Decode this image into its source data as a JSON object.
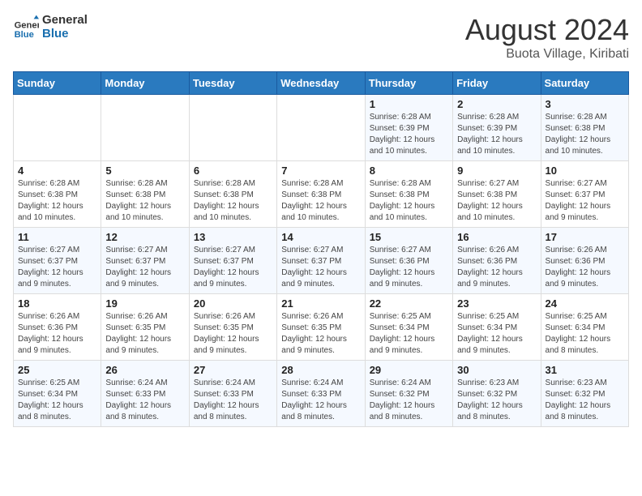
{
  "header": {
    "logo_general": "General",
    "logo_blue": "Blue",
    "title": "August 2024",
    "subtitle": "Buota Village, Kiribati"
  },
  "columns": [
    "Sunday",
    "Monday",
    "Tuesday",
    "Wednesday",
    "Thursday",
    "Friday",
    "Saturday"
  ],
  "weeks": [
    [
      {
        "day": "",
        "info": ""
      },
      {
        "day": "",
        "info": ""
      },
      {
        "day": "",
        "info": ""
      },
      {
        "day": "",
        "info": ""
      },
      {
        "day": "1",
        "info": "Sunrise: 6:28 AM\nSunset: 6:39 PM\nDaylight: 12 hours and 10 minutes."
      },
      {
        "day": "2",
        "info": "Sunrise: 6:28 AM\nSunset: 6:39 PM\nDaylight: 12 hours and 10 minutes."
      },
      {
        "day": "3",
        "info": "Sunrise: 6:28 AM\nSunset: 6:38 PM\nDaylight: 12 hours and 10 minutes."
      }
    ],
    [
      {
        "day": "4",
        "info": "Sunrise: 6:28 AM\nSunset: 6:38 PM\nDaylight: 12 hours and 10 minutes."
      },
      {
        "day": "5",
        "info": "Sunrise: 6:28 AM\nSunset: 6:38 PM\nDaylight: 12 hours and 10 minutes."
      },
      {
        "day": "6",
        "info": "Sunrise: 6:28 AM\nSunset: 6:38 PM\nDaylight: 12 hours and 10 minutes."
      },
      {
        "day": "7",
        "info": "Sunrise: 6:28 AM\nSunset: 6:38 PM\nDaylight: 12 hours and 10 minutes."
      },
      {
        "day": "8",
        "info": "Sunrise: 6:28 AM\nSunset: 6:38 PM\nDaylight: 12 hours and 10 minutes."
      },
      {
        "day": "9",
        "info": "Sunrise: 6:27 AM\nSunset: 6:38 PM\nDaylight: 12 hours and 10 minutes."
      },
      {
        "day": "10",
        "info": "Sunrise: 6:27 AM\nSunset: 6:37 PM\nDaylight: 12 hours and 9 minutes."
      }
    ],
    [
      {
        "day": "11",
        "info": "Sunrise: 6:27 AM\nSunset: 6:37 PM\nDaylight: 12 hours and 9 minutes."
      },
      {
        "day": "12",
        "info": "Sunrise: 6:27 AM\nSunset: 6:37 PM\nDaylight: 12 hours and 9 minutes."
      },
      {
        "day": "13",
        "info": "Sunrise: 6:27 AM\nSunset: 6:37 PM\nDaylight: 12 hours and 9 minutes."
      },
      {
        "day": "14",
        "info": "Sunrise: 6:27 AM\nSunset: 6:37 PM\nDaylight: 12 hours and 9 minutes."
      },
      {
        "day": "15",
        "info": "Sunrise: 6:27 AM\nSunset: 6:36 PM\nDaylight: 12 hours and 9 minutes."
      },
      {
        "day": "16",
        "info": "Sunrise: 6:26 AM\nSunset: 6:36 PM\nDaylight: 12 hours and 9 minutes."
      },
      {
        "day": "17",
        "info": "Sunrise: 6:26 AM\nSunset: 6:36 PM\nDaylight: 12 hours and 9 minutes."
      }
    ],
    [
      {
        "day": "18",
        "info": "Sunrise: 6:26 AM\nSunset: 6:36 PM\nDaylight: 12 hours and 9 minutes."
      },
      {
        "day": "19",
        "info": "Sunrise: 6:26 AM\nSunset: 6:35 PM\nDaylight: 12 hours and 9 minutes."
      },
      {
        "day": "20",
        "info": "Sunrise: 6:26 AM\nSunset: 6:35 PM\nDaylight: 12 hours and 9 minutes."
      },
      {
        "day": "21",
        "info": "Sunrise: 6:26 AM\nSunset: 6:35 PM\nDaylight: 12 hours and 9 minutes."
      },
      {
        "day": "22",
        "info": "Sunrise: 6:25 AM\nSunset: 6:34 PM\nDaylight: 12 hours and 9 minutes."
      },
      {
        "day": "23",
        "info": "Sunrise: 6:25 AM\nSunset: 6:34 PM\nDaylight: 12 hours and 9 minutes."
      },
      {
        "day": "24",
        "info": "Sunrise: 6:25 AM\nSunset: 6:34 PM\nDaylight: 12 hours and 8 minutes."
      }
    ],
    [
      {
        "day": "25",
        "info": "Sunrise: 6:25 AM\nSunset: 6:34 PM\nDaylight: 12 hours and 8 minutes."
      },
      {
        "day": "26",
        "info": "Sunrise: 6:24 AM\nSunset: 6:33 PM\nDaylight: 12 hours and 8 minutes."
      },
      {
        "day": "27",
        "info": "Sunrise: 6:24 AM\nSunset: 6:33 PM\nDaylight: 12 hours and 8 minutes."
      },
      {
        "day": "28",
        "info": "Sunrise: 6:24 AM\nSunset: 6:33 PM\nDaylight: 12 hours and 8 minutes."
      },
      {
        "day": "29",
        "info": "Sunrise: 6:24 AM\nSunset: 6:32 PM\nDaylight: 12 hours and 8 minutes."
      },
      {
        "day": "30",
        "info": "Sunrise: 6:23 AM\nSunset: 6:32 PM\nDaylight: 12 hours and 8 minutes."
      },
      {
        "day": "31",
        "info": "Sunrise: 6:23 AM\nSunset: 6:32 PM\nDaylight: 12 hours and 8 minutes."
      }
    ]
  ]
}
